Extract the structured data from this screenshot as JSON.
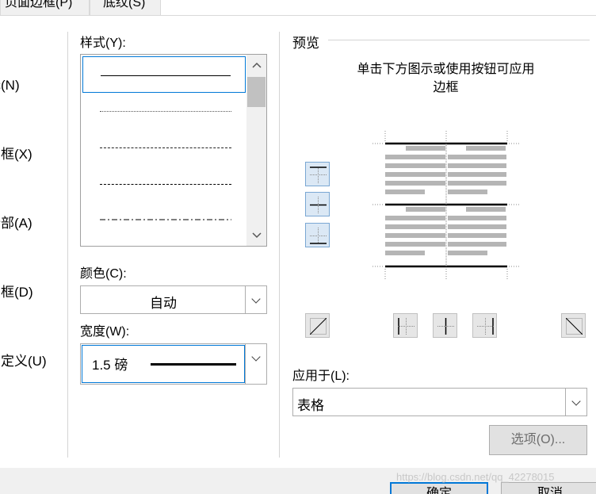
{
  "tabs": [
    {
      "label": "页面边框(P)"
    },
    {
      "label": "底纹(S)"
    }
  ],
  "settings": [
    {
      "label": "无(N)"
    },
    {
      "label": "方框(X)"
    },
    {
      "label": "全部(A)"
    },
    {
      "label": "虚框(D)"
    },
    {
      "label": "自定义(U)"
    }
  ],
  "style": {
    "label": "样式(Y):"
  },
  "color": {
    "label": "颜色(C):",
    "value": "自动"
  },
  "width": {
    "label": "宽度(W):",
    "value": "1.5 磅"
  },
  "preview": {
    "title": "预览",
    "hint_line1": "单击下方图示或使用按钮可应用",
    "hint_line2": "边框"
  },
  "apply": {
    "label": "应用于(L):",
    "value": "表格"
  },
  "buttons": {
    "options": "选项(O)...",
    "ok": "确定",
    "cancel": "取消"
  },
  "watermark": "https://blog.csdn.net/qq_42278015",
  "colors": {
    "accent": "#0078d7",
    "button": "#e1e1e1",
    "panel": "#f0f0f0"
  }
}
